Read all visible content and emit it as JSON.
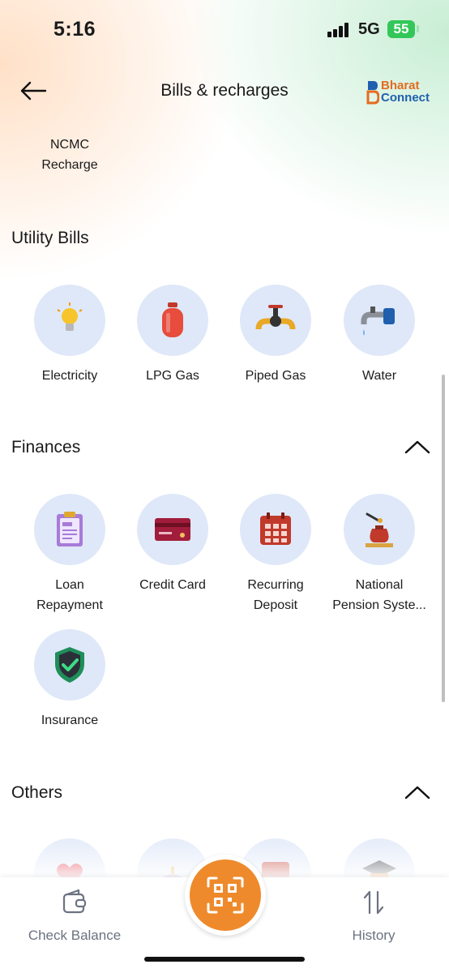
{
  "status_bar": {
    "time": "5:16",
    "network": "5G",
    "battery": "55"
  },
  "header": {
    "title": "Bills & recharges",
    "brand_line1": "Bharat",
    "brand_line2": "Connect"
  },
  "prev_item": {
    "label_line1": "NCMC",
    "label_line2": "Recharge"
  },
  "utility": {
    "title": "Utility Bills",
    "items": [
      {
        "label": "Electricity",
        "icon": "bulb-icon"
      },
      {
        "label": "LPG Gas",
        "icon": "gas-cylinder-icon"
      },
      {
        "label": "Piped Gas",
        "icon": "pipe-icon"
      },
      {
        "label": "Water",
        "icon": "tap-icon"
      }
    ]
  },
  "finances": {
    "title": "Finances",
    "items": [
      {
        "label_line1": "Loan",
        "label_line2": "Repayment",
        "icon": "loan-clipboard-icon"
      },
      {
        "label_line1": "Credit Card",
        "label_line2": "",
        "icon": "credit-card-icon"
      },
      {
        "label_line1": "Recurring",
        "label_line2": "Deposit",
        "icon": "calendar-icon"
      },
      {
        "label_line1": "National",
        "label_line2": "Pension Syste...",
        "icon": "money-bag-icon"
      },
      {
        "label_line1": "Insurance",
        "label_line2": "",
        "icon": "shield-check-icon"
      }
    ]
  },
  "others": {
    "title": "Others"
  },
  "bottom_nav": {
    "check_balance": "Check Balance",
    "history": "History"
  },
  "colors": {
    "accent": "#ee8a2b",
    "circle_bg": "#dfe8f8",
    "brand_orange": "#e56b1f",
    "brand_blue": "#1f5fae"
  }
}
